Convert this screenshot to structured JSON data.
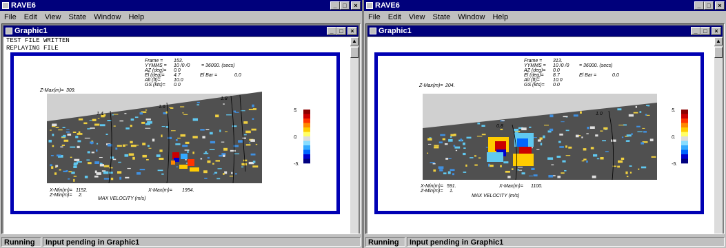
{
  "colors": {
    "title_bar": "#00007b",
    "frame_border": "#0000b4",
    "plot_bg": "#505050",
    "slab": "#d0d0d0"
  },
  "windows": [
    {
      "app_title": "RAVE6",
      "menu": [
        "File",
        "Edit",
        "View",
        "State",
        "Window",
        "Help"
      ],
      "child_title": "Graphic1",
      "console_lines": [
        "TEST FILE WRITTEN",
        "REPLAYING FILE"
      ],
      "info_labels": [
        "Frame =",
        "YYMMS =",
        "AZ (deg)=",
        "El (deg)=",
        "Alt (ft)=",
        "GS (kts)="
      ],
      "info_values": [
        "153.",
        "10 /0 /0",
        "0.0",
        "4.7",
        "10.0",
        "0.0"
      ],
      "time_value": "= 36000.  (secs)",
      "elbar_label": "El Bar =",
      "elbar_value": "0.0",
      "zmax_label": "Z-Max(m)=",
      "zmax_value": "309.",
      "xmin_label": "X-Min(m)=",
      "xmin_value": "1152.",
      "zmin_label": "Z-Min(m)=",
      "zmin_value": "2.",
      "xmax_label": "X-Max(m)=",
      "xmax_value": "1954.",
      "units_label": "MAX VELOCITY (m/s)",
      "contour_labels": [
        "1.4",
        "1.6",
        "1.8"
      ],
      "colorbar_ticks": [
        "5.",
        "0.",
        "-5."
      ],
      "status_state": "Running",
      "status_message": "Input pending in Graphic1"
    },
    {
      "app_title": "RAVE6",
      "menu": [
        "File",
        "Edit",
        "View",
        "State",
        "Window",
        "Help"
      ],
      "child_title": "Graphic1",
      "console_lines": [],
      "info_labels": [
        "Frame =",
        "YYMMS =",
        "AZ (deg)=",
        "El (deg)=",
        "Alt (ft)=",
        "GS (kts)="
      ],
      "info_values": [
        "313.",
        "10 /0 /0",
        "0.0",
        "8.7",
        "10.0",
        "0.0"
      ],
      "time_value": "= 36000.  (secs)",
      "elbar_label": "El Bar =",
      "elbar_value": "0.0",
      "zmax_label": "Z-Max(m)=",
      "zmax_value": "204.",
      "xmin_label": "X-Min(m)=",
      "xmin_value": "591.",
      "zmin_label": "Z-Min(m)=",
      "zmin_value": "1.",
      "xmax_label": "X-Max(m)=",
      "xmax_value": "1100.",
      "units_label": "MAX VELOCITY (m/s)",
      "contour_labels": [
        "0.8",
        "1.0"
      ],
      "colorbar_ticks": [
        "5.",
        "0.",
        "-5."
      ],
      "status_state": "Running",
      "status_message": "Input pending in Graphic1"
    }
  ]
}
